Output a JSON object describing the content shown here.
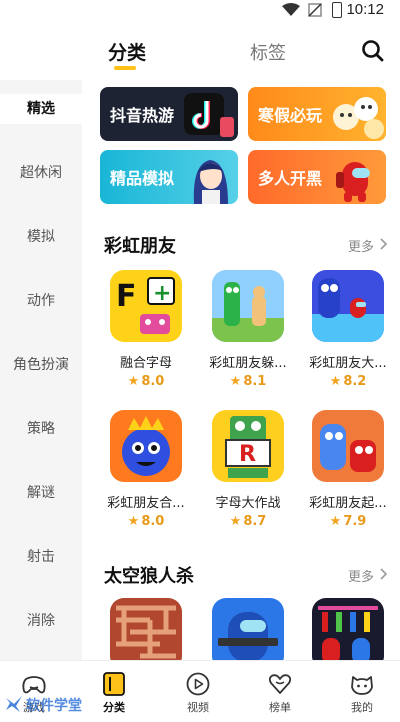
{
  "status_bar": {
    "time": "10:12"
  },
  "top_tabs": {
    "category": "分类",
    "tags": "标签"
  },
  "sidebar": {
    "items": [
      {
        "label": "精选"
      },
      {
        "label": "超休闲"
      },
      {
        "label": "模拟"
      },
      {
        "label": "动作"
      },
      {
        "label": "角色扮演"
      },
      {
        "label": "策略"
      },
      {
        "label": "解谜"
      },
      {
        "label": "射击"
      },
      {
        "label": "消除"
      }
    ],
    "active_index": 0
  },
  "banners": [
    {
      "label": "抖音热游",
      "color": "#1d2333"
    },
    {
      "label": "寒假必玩",
      "color": "#ff9a1f"
    },
    {
      "label": "精品模拟",
      "color": "#2bb8d8"
    },
    {
      "label": "多人开黑",
      "color": "#ff7b2e"
    }
  ],
  "sections": [
    {
      "title": "彩虹朋友",
      "more": "更多",
      "games": [
        {
          "name": "融合字母",
          "rating": "8.0"
        },
        {
          "name": "彩虹朋友躲...",
          "rating": "8.1"
        },
        {
          "name": "彩虹朋友大...",
          "rating": "8.2"
        },
        {
          "name": "彩虹朋友合...",
          "rating": "8.0"
        },
        {
          "name": "字母大作战",
          "rating": "8.7"
        },
        {
          "name": "彩虹朋友起...",
          "rating": "7.9"
        }
      ]
    },
    {
      "title": "太空狼人杀",
      "more": "更多",
      "games": []
    }
  ],
  "bottom_nav": [
    {
      "label": "游戏",
      "icon": "gamepad-icon"
    },
    {
      "label": "分类",
      "icon": "category-icon",
      "active": true
    },
    {
      "label": "视频",
      "icon": "play-icon"
    },
    {
      "label": "榜单",
      "icon": "heart-icon"
    },
    {
      "label": "我的",
      "icon": "cat-icon"
    }
  ],
  "watermark": {
    "text": "软件学堂"
  },
  "colors": {
    "accent": "#ffc21a",
    "rating": "#e89a1c"
  }
}
